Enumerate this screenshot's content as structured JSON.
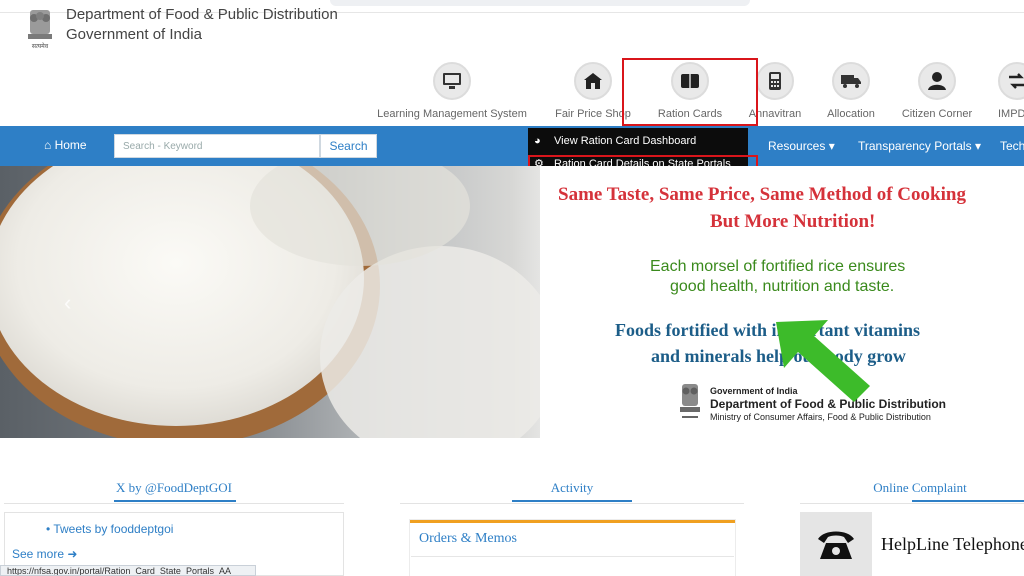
{
  "header": {
    "org_name": "Department of Food & Public Distribution",
    "org_sub": "Government of India",
    "emblem_caption": "सत्यमेव जयते"
  },
  "quick_links": [
    {
      "label": "Learning Management System",
      "icon": "monitor-icon"
    },
    {
      "label": "Fair Price Shop",
      "icon": "shop-icon"
    },
    {
      "label": "Ration Cards",
      "icon": "book-icon"
    },
    {
      "label": "Annavitran",
      "icon": "pos-device-icon"
    },
    {
      "label": "Allocation",
      "icon": "truck-icon"
    },
    {
      "label": "Citizen Corner",
      "icon": "user-icon"
    },
    {
      "label": "IMPD",
      "icon": "exchange-icon"
    }
  ],
  "nav": {
    "home": "Home",
    "search_placeholder": "Search - Keyword",
    "search_button": "Search",
    "resources": "Resources",
    "transparency": "Transparency Portals",
    "tech": "Tech"
  },
  "dropdown": {
    "item1": "View Ration Card Dashboard",
    "item2": "Ration Card Details on State Portals"
  },
  "hero": {
    "line1": "Same Taste, Same Price, Same Method of Cooking",
    "line2": "But More Nutrition!",
    "line3": "Each morsel of fortified rice ensures",
    "line4": "good health, nutrition and taste.",
    "line5": "Foods fortified with important vitamins",
    "line6": "and minerals help our body grow",
    "gov1": "Government of India",
    "gov2": "Department of Food & Public Distribution",
    "gov3": "Ministry of Consumer Affairs, Food & Public Distribution"
  },
  "panels": {
    "twitter_title": "X by @FoodDeptGOI",
    "tweets_link": "Tweets by fooddeptgoi",
    "see_more": "See more",
    "activity_title": "Activity",
    "orders_title": "Orders & Memos",
    "complaint_title": "Online Complaint",
    "helpline": "HelpLine Telephone"
  },
  "status_url": "https://nfsa.gov.in/portal/Ration_Card_State_Portals_AA",
  "colors": {
    "nav_blue": "#2e7fc6",
    "highlight_red": "#d9151b",
    "arrow_green": "#3dbb2a"
  }
}
